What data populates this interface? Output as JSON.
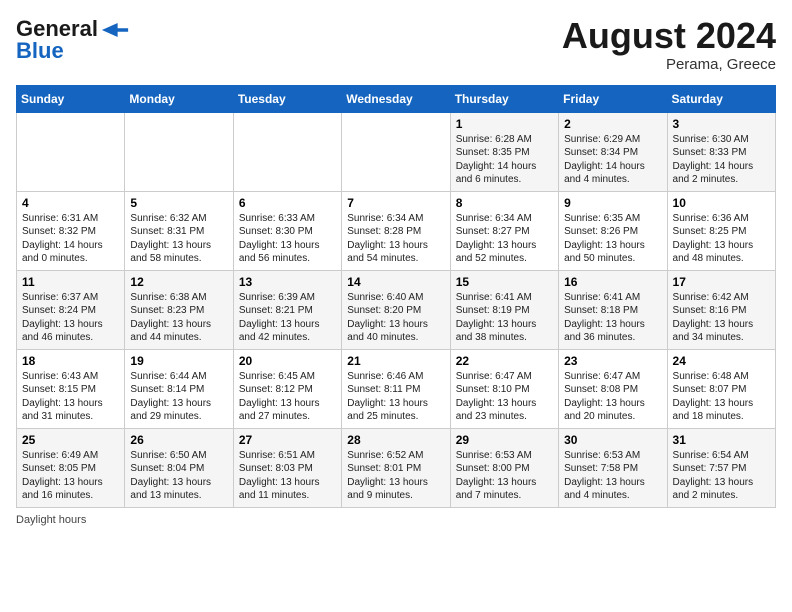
{
  "header": {
    "logo_line1": "General",
    "logo_line2": "Blue",
    "month_year": "August 2024",
    "location": "Perama, Greece"
  },
  "days_of_week": [
    "Sunday",
    "Monday",
    "Tuesday",
    "Wednesday",
    "Thursday",
    "Friday",
    "Saturday"
  ],
  "weeks": [
    [
      {
        "day": "",
        "text": ""
      },
      {
        "day": "",
        "text": ""
      },
      {
        "day": "",
        "text": ""
      },
      {
        "day": "",
        "text": ""
      },
      {
        "day": "1",
        "text": "Sunrise: 6:28 AM\nSunset: 8:35 PM\nDaylight: 14 hours and 6 minutes."
      },
      {
        "day": "2",
        "text": "Sunrise: 6:29 AM\nSunset: 8:34 PM\nDaylight: 14 hours and 4 minutes."
      },
      {
        "day": "3",
        "text": "Sunrise: 6:30 AM\nSunset: 8:33 PM\nDaylight: 14 hours and 2 minutes."
      }
    ],
    [
      {
        "day": "4",
        "text": "Sunrise: 6:31 AM\nSunset: 8:32 PM\nDaylight: 14 hours and 0 minutes."
      },
      {
        "day": "5",
        "text": "Sunrise: 6:32 AM\nSunset: 8:31 PM\nDaylight: 13 hours and 58 minutes."
      },
      {
        "day": "6",
        "text": "Sunrise: 6:33 AM\nSunset: 8:30 PM\nDaylight: 13 hours and 56 minutes."
      },
      {
        "day": "7",
        "text": "Sunrise: 6:34 AM\nSunset: 8:28 PM\nDaylight: 13 hours and 54 minutes."
      },
      {
        "day": "8",
        "text": "Sunrise: 6:34 AM\nSunset: 8:27 PM\nDaylight: 13 hours and 52 minutes."
      },
      {
        "day": "9",
        "text": "Sunrise: 6:35 AM\nSunset: 8:26 PM\nDaylight: 13 hours and 50 minutes."
      },
      {
        "day": "10",
        "text": "Sunrise: 6:36 AM\nSunset: 8:25 PM\nDaylight: 13 hours and 48 minutes."
      }
    ],
    [
      {
        "day": "11",
        "text": "Sunrise: 6:37 AM\nSunset: 8:24 PM\nDaylight: 13 hours and 46 minutes."
      },
      {
        "day": "12",
        "text": "Sunrise: 6:38 AM\nSunset: 8:23 PM\nDaylight: 13 hours and 44 minutes."
      },
      {
        "day": "13",
        "text": "Sunrise: 6:39 AM\nSunset: 8:21 PM\nDaylight: 13 hours and 42 minutes."
      },
      {
        "day": "14",
        "text": "Sunrise: 6:40 AM\nSunset: 8:20 PM\nDaylight: 13 hours and 40 minutes."
      },
      {
        "day": "15",
        "text": "Sunrise: 6:41 AM\nSunset: 8:19 PM\nDaylight: 13 hours and 38 minutes."
      },
      {
        "day": "16",
        "text": "Sunrise: 6:41 AM\nSunset: 8:18 PM\nDaylight: 13 hours and 36 minutes."
      },
      {
        "day": "17",
        "text": "Sunrise: 6:42 AM\nSunset: 8:16 PM\nDaylight: 13 hours and 34 minutes."
      }
    ],
    [
      {
        "day": "18",
        "text": "Sunrise: 6:43 AM\nSunset: 8:15 PM\nDaylight: 13 hours and 31 minutes."
      },
      {
        "day": "19",
        "text": "Sunrise: 6:44 AM\nSunset: 8:14 PM\nDaylight: 13 hours and 29 minutes."
      },
      {
        "day": "20",
        "text": "Sunrise: 6:45 AM\nSunset: 8:12 PM\nDaylight: 13 hours and 27 minutes."
      },
      {
        "day": "21",
        "text": "Sunrise: 6:46 AM\nSunset: 8:11 PM\nDaylight: 13 hours and 25 minutes."
      },
      {
        "day": "22",
        "text": "Sunrise: 6:47 AM\nSunset: 8:10 PM\nDaylight: 13 hours and 23 minutes."
      },
      {
        "day": "23",
        "text": "Sunrise: 6:47 AM\nSunset: 8:08 PM\nDaylight: 13 hours and 20 minutes."
      },
      {
        "day": "24",
        "text": "Sunrise: 6:48 AM\nSunset: 8:07 PM\nDaylight: 13 hours and 18 minutes."
      }
    ],
    [
      {
        "day": "25",
        "text": "Sunrise: 6:49 AM\nSunset: 8:05 PM\nDaylight: 13 hours and 16 minutes."
      },
      {
        "day": "26",
        "text": "Sunrise: 6:50 AM\nSunset: 8:04 PM\nDaylight: 13 hours and 13 minutes."
      },
      {
        "day": "27",
        "text": "Sunrise: 6:51 AM\nSunset: 8:03 PM\nDaylight: 13 hours and 11 minutes."
      },
      {
        "day": "28",
        "text": "Sunrise: 6:52 AM\nSunset: 8:01 PM\nDaylight: 13 hours and 9 minutes."
      },
      {
        "day": "29",
        "text": "Sunrise: 6:53 AM\nSunset: 8:00 PM\nDaylight: 13 hours and 7 minutes."
      },
      {
        "day": "30",
        "text": "Sunrise: 6:53 AM\nSunset: 7:58 PM\nDaylight: 13 hours and 4 minutes."
      },
      {
        "day": "31",
        "text": "Sunrise: 6:54 AM\nSunset: 7:57 PM\nDaylight: 13 hours and 2 minutes."
      }
    ]
  ],
  "footer": "Daylight hours"
}
